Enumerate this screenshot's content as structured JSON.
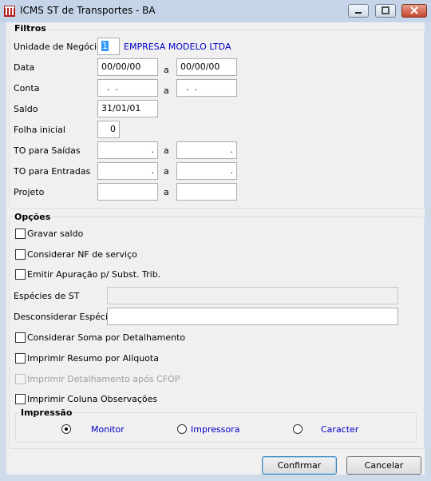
{
  "window": {
    "title": "ICMS ST de Transportes - BA"
  },
  "filtros": {
    "group_label": "Filtros",
    "unidade_label": "Unidade de Negócio",
    "unidade_value": "1",
    "unidade_name": "EMPRESA MODELO LTDA",
    "data_label": "Data",
    "data_from": "00/00/00",
    "data_to": "00/00/00",
    "conta_label": "Conta",
    "conta_from": "  .  .",
    "conta_to": "  .  .",
    "saldo_label": "Saldo",
    "saldo_value": "31/01/01",
    "folha_label": "Folha inicial",
    "folha_value": "0",
    "to_saidas_label": "TO para Saídas",
    "to_saidas_from": ".",
    "to_saidas_to": ".",
    "to_entradas_label": "TO para Entradas",
    "to_entradas_from": ".",
    "to_entradas_to": ".",
    "projeto_label": "Projeto",
    "projeto_from": "",
    "projeto_to": "",
    "range_sep": "a"
  },
  "opcoes": {
    "group_label": "Opções",
    "gravar_saldo": "Gravar saldo",
    "considerar_nf": "Considerar NF de serviço",
    "emitir_apuracao": "Emitir Apuração p/ Subst. Trib.",
    "especies_st_label": "Espécies de ST",
    "especies_st_value": "",
    "desconsiderar_label": "Desconsiderar Espécie",
    "desconsiderar_value": "",
    "considerar_soma": "Considerar Soma por Detalhamento",
    "imprimir_resumo": "Imprimir Resumo por Alíquota",
    "imprimir_detalhamento": "Imprimir Detalhamento após CFOP",
    "imprimir_coluna": "Imprimir Coluna Observações"
  },
  "impressao": {
    "group_label": "Impressão",
    "monitor": "Monitor",
    "impressora": "Impressora",
    "caracter": "Caracter",
    "selected": "Monitor"
  },
  "buttons": {
    "confirmar": "Confirmar",
    "cancelar": "Cancelar"
  }
}
